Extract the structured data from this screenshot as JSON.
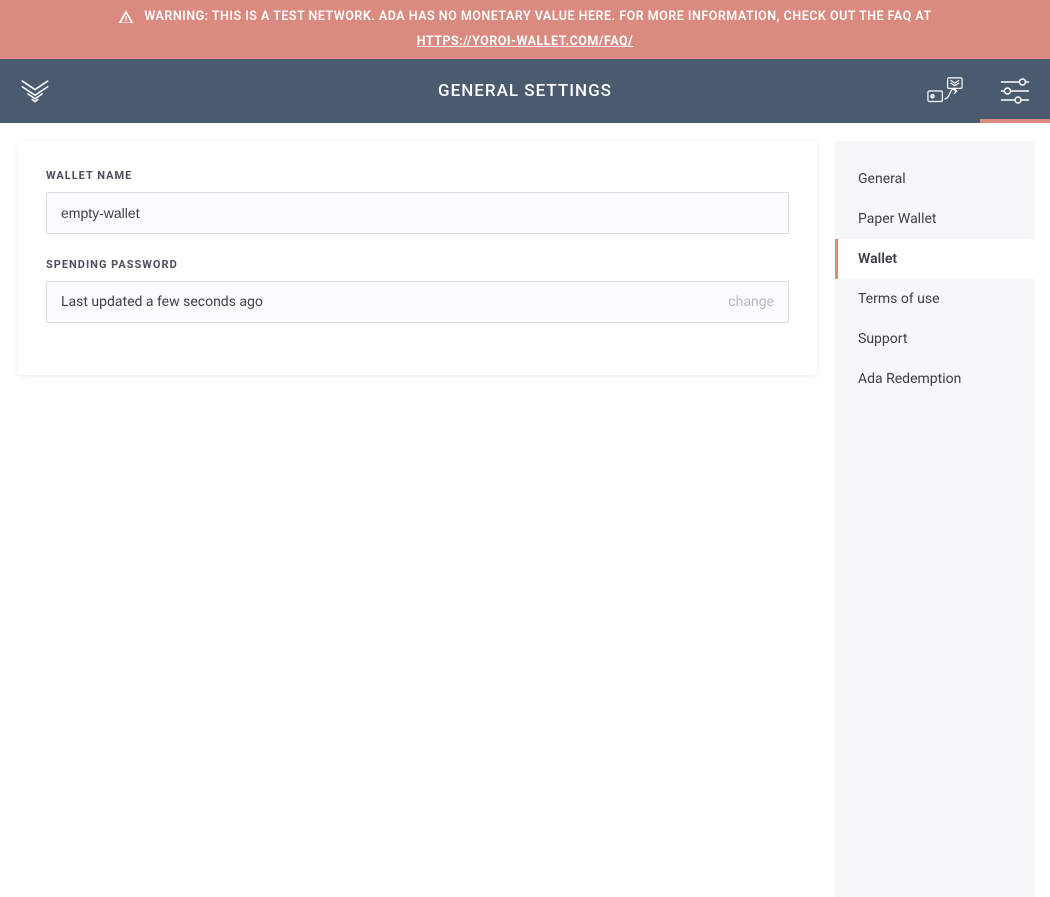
{
  "warning": {
    "text": "WARNING: THIS IS A TEST NETWORK. ADA HAS NO MONETARY VALUE HERE. FOR MORE INFORMATION, CHECK OUT THE FAQ AT ",
    "link_text": "HTTPS://YOROI-WALLET.COM/FAQ/"
  },
  "header": {
    "title": "GENERAL SETTINGS"
  },
  "form": {
    "wallet_name_label": "WALLET NAME",
    "wallet_name_value": "empty-wallet",
    "spending_password_label": "SPENDING PASSWORD",
    "spending_password_status": "Last updated a few seconds ago",
    "change_label": "change"
  },
  "sidebar": {
    "items": [
      {
        "label": "General",
        "active": false
      },
      {
        "label": "Paper Wallet",
        "active": false
      },
      {
        "label": "Wallet",
        "active": true
      },
      {
        "label": "Terms of use",
        "active": false
      },
      {
        "label": "Support",
        "active": false
      },
      {
        "label": "Ada Redemption",
        "active": false
      }
    ]
  }
}
